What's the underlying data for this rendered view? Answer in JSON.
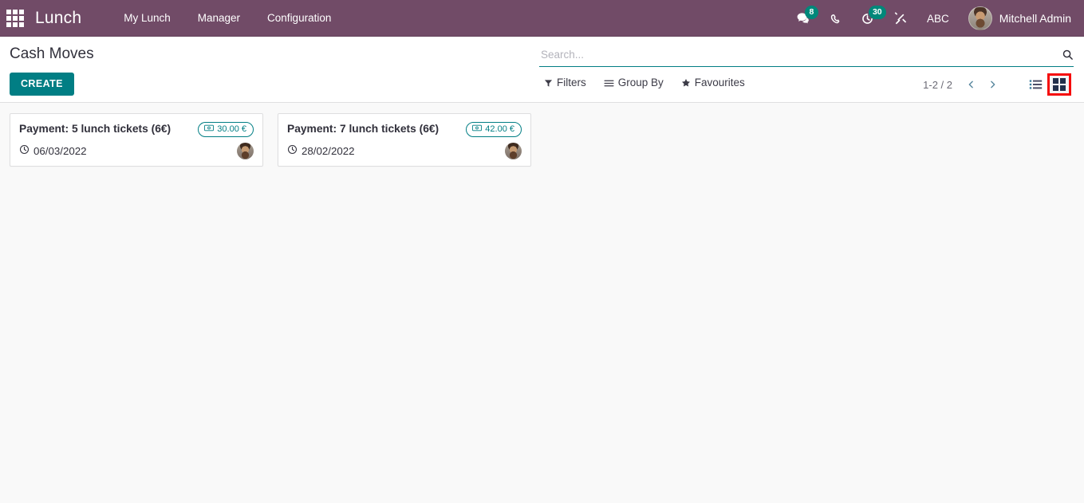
{
  "navbar": {
    "apps_icon": "apps-grid-icon",
    "brand": "Lunch",
    "menu": [
      {
        "label": "My Lunch"
      },
      {
        "label": "Manager"
      },
      {
        "label": "Configuration"
      }
    ],
    "systray": {
      "messaging_icon": "messaging-icon",
      "messaging_count": "8",
      "phone_icon": "phone-icon",
      "activities_icon": "activities-clock-icon",
      "activities_count": "30",
      "tools_icon": "tools-icon",
      "abc_label": "ABC"
    },
    "user": {
      "avatar_icon": "user-avatar",
      "name": "Mitchell Admin"
    },
    "brand_color": "#714b67",
    "badge_color": "#00887a"
  },
  "control_panel": {
    "title": "Cash Moves",
    "create_label": "CREATE",
    "create_color": "#017e84",
    "search": {
      "placeholder": "Search...",
      "value": "",
      "icon": "search-icon",
      "underline_color": "#017e84"
    },
    "filters": [
      {
        "label": "Filters",
        "icon": "funnel-icon"
      },
      {
        "label": "Group By",
        "icon": "list-lines-icon"
      },
      {
        "label": "Favourites",
        "icon": "star-icon"
      }
    ],
    "pager": {
      "range": "1-2 / 2",
      "prev_icon": "chevron-left-icon",
      "next_icon": "chevron-right-icon",
      "arrow_color": "#58879e"
    },
    "views": [
      {
        "name": "list",
        "icon": "list-view-icon",
        "active": false
      },
      {
        "name": "kanban",
        "icon": "kanban-view-icon",
        "active": true
      }
    ],
    "highlight_color": "#f50b0b"
  },
  "kanban": {
    "cards": [
      {
        "title": "Payment: 5 lunch tickets (6€)",
        "amount": "30.00 €",
        "amount_icon": "money-bill-icon",
        "date": "06/03/2022",
        "date_icon": "clock-icon",
        "avatar_icon": "user-avatar"
      },
      {
        "title": "Payment: 7 lunch tickets (6€)",
        "amount": "42.00 €",
        "amount_icon": "money-bill-icon",
        "date": "28/02/2022",
        "date_icon": "clock-icon",
        "avatar_icon": "user-avatar"
      }
    ]
  }
}
